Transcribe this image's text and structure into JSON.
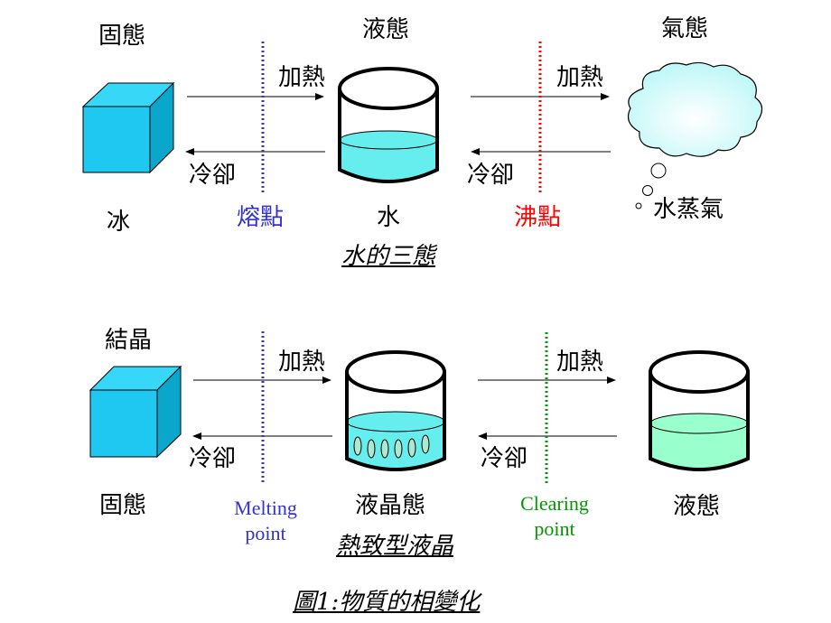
{
  "colors": {
    "melting_line": "#3333cc",
    "boiling_line": "#ff0000",
    "clearing_line": "#009900",
    "melting_text": "#3333cc",
    "boiling_text": "#ff0000",
    "clearing_text": "#009900",
    "ice_front": "#1ec8f0",
    "ice_side": "#0aa6cc",
    "ice_top": "#37d7f7",
    "water": "#66eeee",
    "liquid_green": "#99ffcc",
    "cloud": "#ccfcfc"
  },
  "water_section": {
    "solid_state": "固態",
    "liquid_state": "液態",
    "gas_state": "氣態",
    "heat_1": "加熱",
    "cool_1": "冷卻",
    "heat_2": "加熱",
    "cool_2": "冷卻",
    "ice": "冰",
    "water": "水",
    "vapor": "水蒸氣",
    "melting_point": "熔點",
    "boiling_point": "沸點",
    "caption": "水的三態"
  },
  "lc_section": {
    "crystal": "結晶",
    "solid_state": "固態",
    "lc_state": "液晶態",
    "liquid_state": "液態",
    "heat_1": "加熱",
    "cool_1": "冷卻",
    "heat_2": "加熱",
    "cool_2": "冷卻",
    "melting_point_line1": "Melting",
    "melting_point_line2": "point",
    "clearing_point_line1": "Clearing",
    "clearing_point_line2": "point",
    "caption": "熱致型液晶"
  },
  "figure_caption": "圖1:物質的相變化"
}
